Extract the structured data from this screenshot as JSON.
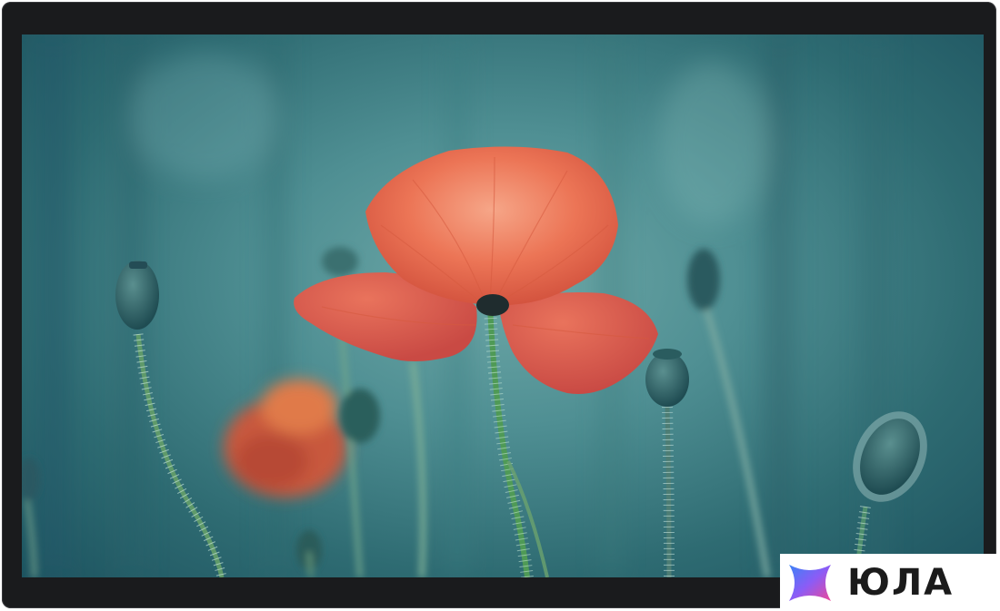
{
  "image": {
    "subject": "poppy",
    "device": "display-monitor"
  },
  "watermark": {
    "brand_text": "ЮЛА",
    "logo_colors": [
      "#8b5cf6",
      "#3b82f6",
      "#ec4899"
    ]
  },
  "colors": {
    "bezel": "#1a1b1d",
    "background": "#3f7f86",
    "petal": "#e8694f",
    "stem": "#4f9a63"
  }
}
